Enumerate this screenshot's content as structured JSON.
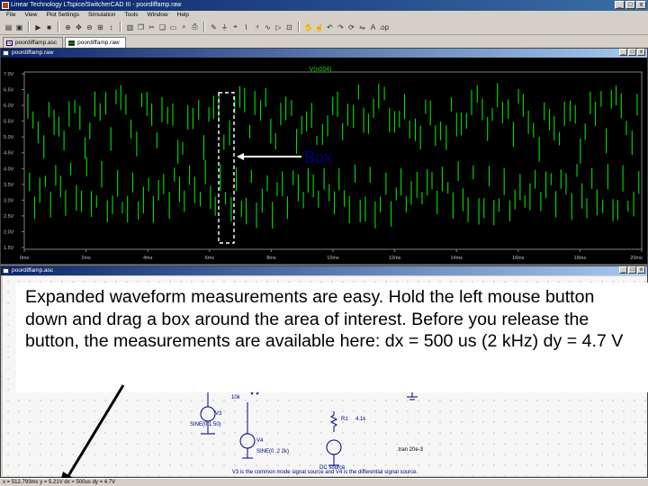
{
  "window": {
    "title": "Linear Technology LTspice/SwitcherCAD III - poordiffamp.raw",
    "buttons": [
      "_",
      "□",
      "x"
    ]
  },
  "menu": [
    "File",
    "View",
    "Plot Settings",
    "Simulation",
    "Tools",
    "Window",
    "Help"
  ],
  "tabs": [
    {
      "label": "poordiffamp.asc",
      "active": false
    },
    {
      "label": "poordiffamp.raw",
      "active": true
    }
  ],
  "wave_pane": {
    "title": "poordiffamp.raw",
    "trace_name": "V(n004)",
    "trace_color": "#00e000",
    "y_ticks": [
      "7.0V",
      "6.5V",
      "6.0V",
      "5.5V",
      "5.0V",
      "4.5V",
      "4.0V",
      "3.5V",
      "3.0V",
      "2.5V",
      "2.0V",
      "1.5V"
    ],
    "x_ticks": [
      "0ms",
      "2ms",
      "4ms",
      "6ms",
      "8ms",
      "10ms",
      "12ms",
      "14ms",
      "16ms",
      "18ms",
      "20ms"
    ],
    "box_label": "Box",
    "box_label_color": "#000080"
  },
  "schem_pane": {
    "title": "poordiffamp.asc",
    "components": {
      "v3_source": "SINE(0 1 50)",
      "v3_name": "V3",
      "v4_name": "V4",
      "v4_source": "SINE(0 .2 2k)",
      "r1_name": "R1",
      "r1_value": "4.1k",
      "r_value": "10k",
      "dc_source": "DC source",
      "tran": ".tran 20e-3"
    },
    "note": "V3 is the common mode signal source and V4 is the differential signal source."
  },
  "callout": {
    "text": "Expanded waveform measurements are easy.  Hold the left mouse button down and drag a box around the area of interest.  Before you release the button, the measurements are available here:  dx = 500 us (2 kHz) dy = 4.7 V"
  },
  "status": {
    "text": "x = 512.793ms   y = 5.21V   dx = 500us   dy = 4.7V"
  }
}
